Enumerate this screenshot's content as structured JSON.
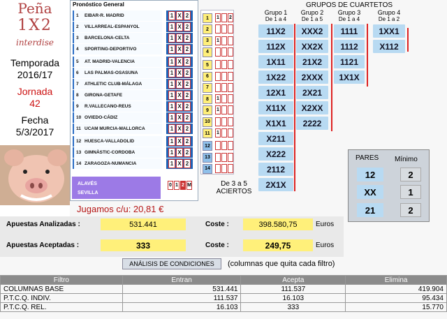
{
  "left": {
    "brand_line1": "Peña",
    "brand_line2": "1X2",
    "brand_line3": "interdise",
    "temporada_label": "Temporada",
    "temporada_value": "2016/17",
    "jornada_label": "Jornada",
    "jornada_value": "42",
    "fecha_label": "Fecha",
    "fecha_value": "5/3/2017"
  },
  "pronostico": {
    "title": "Pronóstico General",
    "matches": [
      {
        "n": "1",
        "name": "EIBAR-R. MADRID",
        "c": [
          "1",
          "X",
          "2"
        ]
      },
      {
        "n": "2",
        "name": "VILLARREAL-ESPANYOL",
        "c": [
          "1",
          "X",
          "2"
        ]
      },
      {
        "n": "3",
        "name": "BARCELONA-CELTA",
        "c": [
          "1",
          "X",
          "2"
        ]
      },
      {
        "n": "4",
        "name": "SPORTING-DEPORTIVO",
        "c": [
          "1",
          "X",
          "2"
        ]
      },
      {
        "n": "5",
        "name": "AT. MADRID-VALENCIA",
        "c": [
          "1",
          "X",
          "2"
        ]
      },
      {
        "n": "6",
        "name": "LAS PALMAS-OSASUNA",
        "c": [
          "1",
          "X",
          "2"
        ]
      },
      {
        "n": "7",
        "name": "ATHLETIC CLUB-MÁLAGA",
        "c": [
          "1",
          "X",
          "2"
        ]
      },
      {
        "n": "8",
        "name": "GIRONA-GETAFE",
        "c": [
          "1",
          "X",
          "2"
        ]
      },
      {
        "n": "9",
        "name": "R.VALLECANO-REUS",
        "c": [
          "1",
          "X",
          "2"
        ]
      },
      {
        "n": "10",
        "name": "OVIEDO-CÁDIZ",
        "c": [
          "1",
          "X",
          "2"
        ]
      },
      {
        "n": "11",
        "name": "UCAM MURCIA-MALLORCA",
        "c": [
          "1",
          "X",
          "2"
        ]
      },
      {
        "n": "12",
        "name": "HUESCA-VALLADOLID",
        "c": [
          "1",
          "X",
          "2"
        ]
      },
      {
        "n": "13",
        "name": "GIMNÀSTIC-CORDOBA",
        "c": [
          "1",
          "X",
          "2"
        ]
      },
      {
        "n": "14",
        "name": "ZARAGOZA-NUMANCIA",
        "c": [
          "1",
          "X",
          "2"
        ]
      }
    ],
    "pleno_home": "ALAVÉS",
    "pleno_away": "SEVILLA",
    "pleno_cells": [
      "0",
      "1",
      "2",
      "M"
    ]
  },
  "col2": {
    "nums": [
      "1",
      "2",
      "3",
      "4",
      "5",
      "6",
      "7",
      "8",
      "9",
      "10",
      "11",
      "12",
      "13",
      "14"
    ],
    "c1": [
      "1",
      "",
      "1",
      "",
      "",
      "",
      "",
      "1",
      "1",
      "",
      "1",
      "",
      "",
      ""
    ],
    "c3": [
      "2",
      "",
      "",
      "",
      "",
      "",
      "",
      "",
      "",
      "",
      "",
      "",
      "",
      ""
    ],
    "aciertos_line1": "De 3 a 5",
    "aciertos_line2": "ACIERTOS"
  },
  "grupos": {
    "title": "GRUPOS DE CUARTETOS",
    "g1_h": "Grupo 1",
    "g1_s": "De 1 a 4",
    "g2_h": "Grupo 2",
    "g2_s": "De 1 a 5",
    "g3_h": "Grupo 3",
    "g3_s": "De 1 a 4",
    "g4_h": "Grupo 4",
    "g4_s": "De 1 a 2",
    "g1": [
      "11X2",
      "112X",
      "1X11",
      "1X22",
      "12X1",
      "X11X",
      "X1X1",
      "X211",
      "X222",
      "2112",
      "2X1X"
    ],
    "g2": [
      "XXX2",
      "XX2X",
      "21X2",
      "2XXX",
      "2X21",
      "X2XX",
      "2222"
    ],
    "g3": [
      "1111",
      "1112",
      "1121",
      "1X1X"
    ],
    "g4": [
      "1XX1",
      "X112"
    ]
  },
  "pares": {
    "pares_label": "PARES",
    "minimo_label": "Mínimo",
    "pares": [
      "12",
      "XX",
      "21"
    ],
    "minimo": [
      "2",
      "1",
      "2"
    ]
  },
  "jugamos": "Jugamos c/u: 20,81 €",
  "apuestas": {
    "analizadas_label": "Apuestas Analizadas :",
    "analizadas_value": "531.441",
    "coste1_label": "Coste :",
    "coste1_value": "398.580,75",
    "euros1": "Euros",
    "aceptadas_label": "Apuestas Aceptadas :",
    "aceptadas_value": "333",
    "coste2_label": "Coste :",
    "coste2_value": "249,75",
    "euros2": "Euros"
  },
  "analisis_button": "ANÁLISIS DE CONDICIONES",
  "analisis_note": "(columnas que quita cada filtro)",
  "table": {
    "headers": [
      "Filtro",
      "Entran",
      "Acepta",
      "Elimina"
    ],
    "rows": [
      [
        "COLUMNAS BASE",
        "531.441",
        "111.537",
        "419.904"
      ],
      [
        "P.T.C.Q. INDIV.",
        "111.537",
        "16.103",
        "95.434"
      ],
      [
        "P.T.C.Q. REL.",
        "16.103",
        "333",
        "15.770"
      ]
    ]
  },
  "colors": {
    "accent_blue": "#1f62b6",
    "red": "#c33",
    "yellow": "#fff07a",
    "light_blue": "#b8daf2",
    "violet": "#9c7ae6"
  }
}
